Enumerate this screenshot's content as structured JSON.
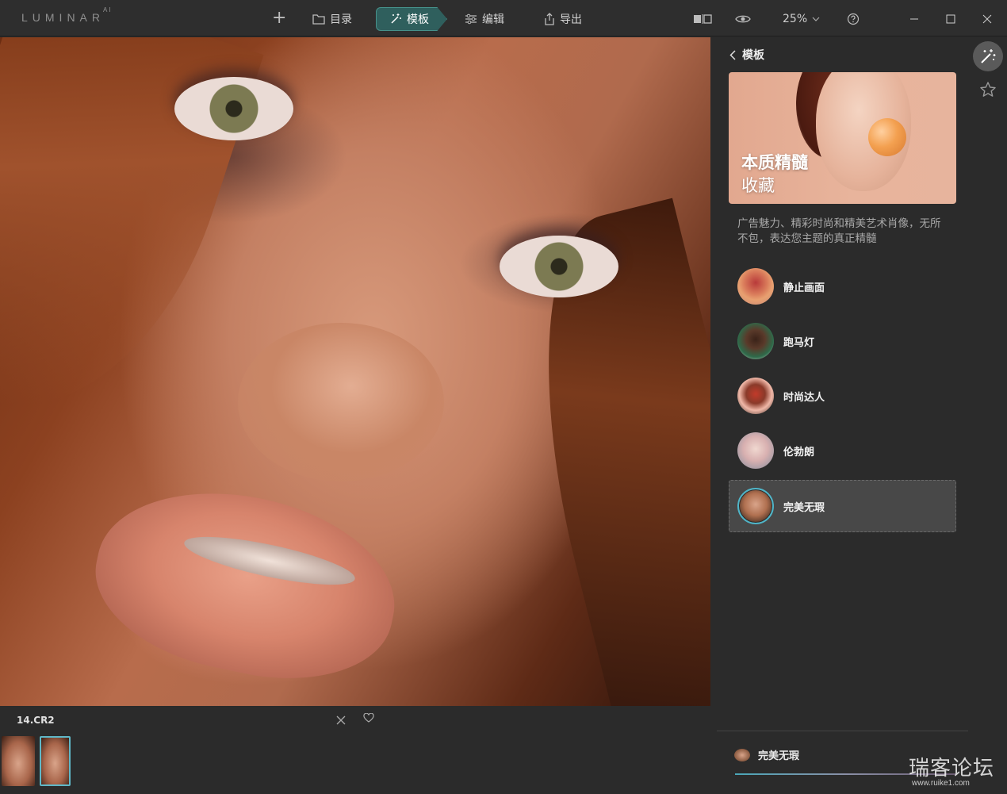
{
  "app": {
    "logo_text": "LUMINAR",
    "logo_sup": "AI"
  },
  "toolbar": {
    "add_label": "+",
    "catalog_label": "目录",
    "templates_label": "模板",
    "edit_label": "编辑",
    "export_label": "导出",
    "zoom_label": "25%",
    "active_tab_color": "#2f5f5d"
  },
  "filmstrip": {
    "filename": "14.CR2",
    "selected_index": 1
  },
  "panel": {
    "back_label": "模板",
    "hero": {
      "title": "本质精髓",
      "subtitle": "收藏"
    },
    "description": "广告魅力、精彩时尚和精美艺术肖像，无所不包，表达您主题的真正精髓",
    "templates": [
      {
        "label": "静止画面",
        "active": false
      },
      {
        "label": "跑马灯",
        "active": false
      },
      {
        "label": "时尚达人",
        "active": false
      },
      {
        "label": "伦勃朗",
        "active": false
      },
      {
        "label": "完美无瑕",
        "active": true
      }
    ],
    "applied_label": "完美无瑕",
    "accent_color": "#4fb5c8"
  },
  "watermark": {
    "text": "瑞客论坛",
    "url": "www.ruike1.com"
  }
}
